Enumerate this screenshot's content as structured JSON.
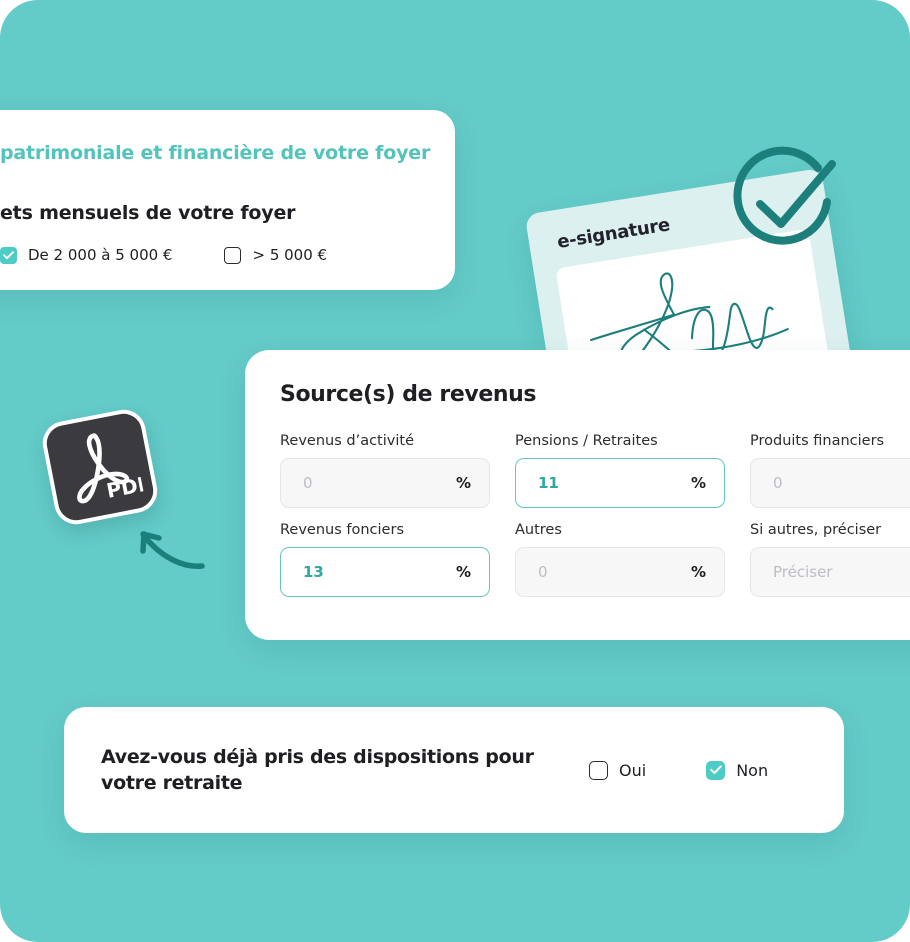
{
  "theme": {
    "background_teal": "#63CBC8",
    "accent_teal": "#4DCBC6",
    "heading_teal": "#53C4BC",
    "value_teal": "#2FA8A2",
    "dark_teal": "#1C7F7C",
    "card_white": "#FFFFFF",
    "signature_card": "#DCF0F0",
    "pdf_dark": "#3B3B3F",
    "text_dark": "#1F1F23"
  },
  "household_card": {
    "title": "patrimoniale et financière de votre foyer",
    "subtitle": "ets mensuels de votre foyer",
    "options": [
      {
        "label": "De 2 000 à 5 000 €",
        "checked": true
      },
      {
        "label": "> 5 000 €",
        "checked": false
      }
    ]
  },
  "signature_card": {
    "label": "e-signature",
    "signature_icon": "handwritten-signature-scribble",
    "badge_icon": "check-circle-icon"
  },
  "pdf_badge": {
    "label": "PDF",
    "icon": "pdf-file-icon",
    "arrow_icon": "curved-arrow-icon"
  },
  "revenus_card": {
    "title": "Source(s) de revenus",
    "fields": [
      {
        "label": "Revenus d’activité",
        "value": "0",
        "placeholder": "0",
        "suffix": "%",
        "state": "inactive",
        "has_suffix": true
      },
      {
        "label": "Pensions / Retraites",
        "value": "11",
        "placeholder": "0",
        "suffix": "%",
        "state": "active",
        "has_suffix": true
      },
      {
        "label": "Produits financiers",
        "value": "0",
        "placeholder": "0",
        "suffix": "%",
        "state": "inactive",
        "has_suffix": true
      },
      {
        "label": "Revenus fonciers",
        "value": "13",
        "placeholder": "0",
        "suffix": "%",
        "state": "active",
        "has_suffix": true
      },
      {
        "label": "Autres",
        "value": "0",
        "placeholder": "0",
        "suffix": "%",
        "state": "inactive",
        "has_suffix": true
      },
      {
        "label": "Si autres, préciser",
        "value": "",
        "placeholder": "Préciser",
        "suffix": "",
        "state": "inactive",
        "has_suffix": false
      }
    ]
  },
  "retraite_card": {
    "question_line1": "Avez-vous déjà pris des dispositions pour",
    "question_line2": "votre retraite",
    "options": [
      {
        "label": "Oui",
        "checked": false
      },
      {
        "label": "Non",
        "checked": true
      }
    ]
  }
}
